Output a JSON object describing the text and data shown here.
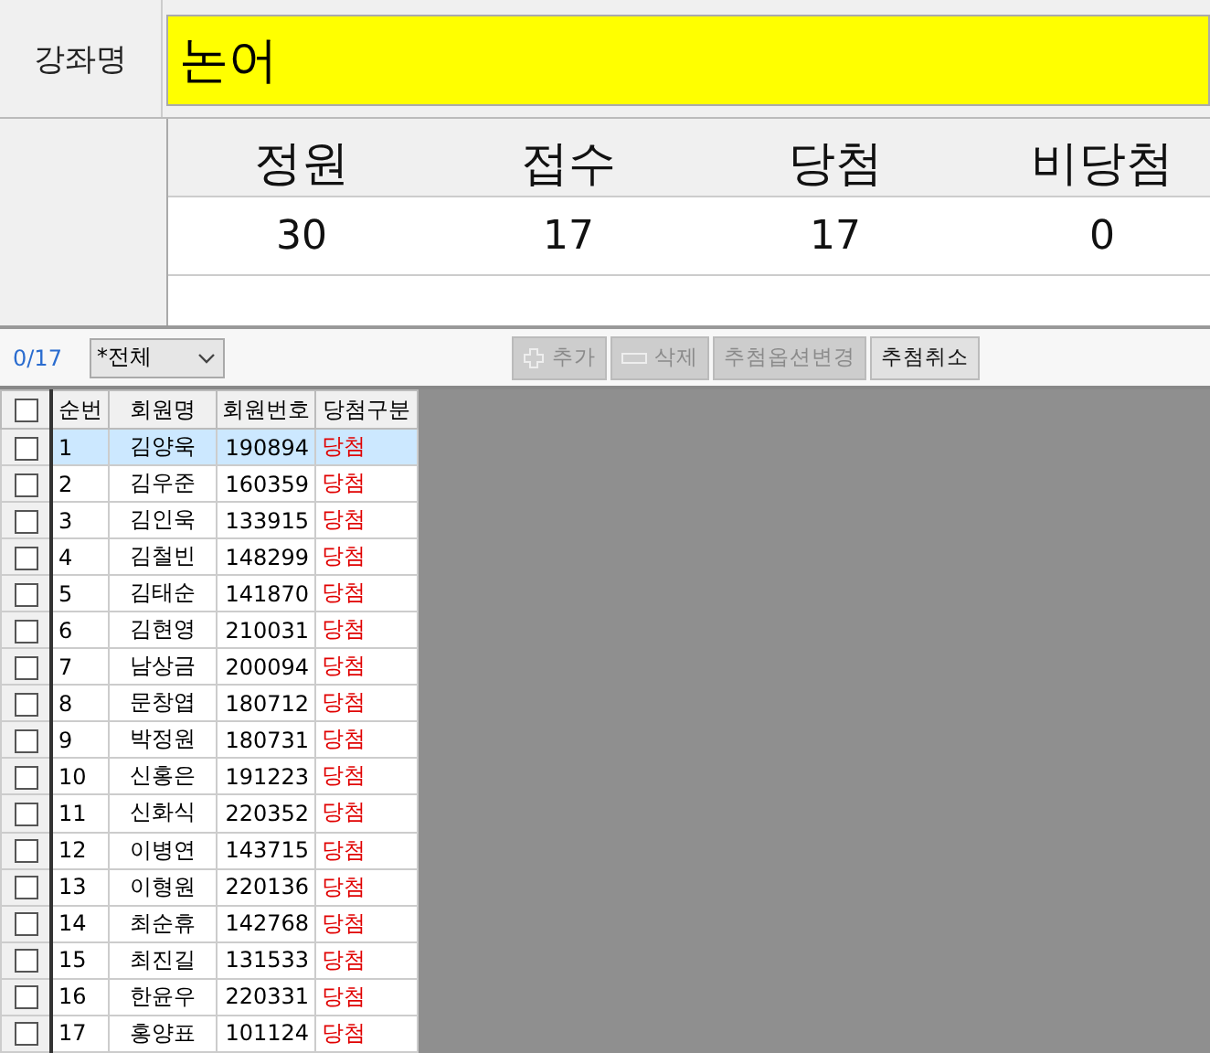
{
  "course": {
    "label": "강좌명",
    "value": "논어"
  },
  "stats": [
    {
      "header": "정원",
      "value": "30"
    },
    {
      "header": "접수",
      "value": "17"
    },
    {
      "header": "당첨",
      "value": "17"
    },
    {
      "header": "비당첨",
      "value": "0"
    }
  ],
  "toolbar": {
    "count": "0/17",
    "filter": "*전체",
    "buttons": [
      {
        "label": "추가",
        "kind": "plus",
        "disabled": true
      },
      {
        "label": "삭제",
        "kind": "minus",
        "disabled": true
      },
      {
        "label": "추첨옵션변경",
        "disabled": true
      },
      {
        "label": "추첨취소",
        "disabled": false
      }
    ]
  },
  "table": {
    "columns": [
      "순번",
      "회원명",
      "회원번호",
      "당첨구분"
    ],
    "header_checked": false,
    "rows": [
      {
        "no": "1",
        "name": "김양욱",
        "id": "190894",
        "result": "당첨",
        "checked": false,
        "selected": true
      },
      {
        "no": "2",
        "name": "김우준",
        "id": "160359",
        "result": "당첨",
        "checked": false,
        "selected": false
      },
      {
        "no": "3",
        "name": "김인욱",
        "id": "133915",
        "result": "당첨",
        "checked": false,
        "selected": false
      },
      {
        "no": "4",
        "name": "김철빈",
        "id": "148299",
        "result": "당첨",
        "checked": false,
        "selected": false
      },
      {
        "no": "5",
        "name": "김태순",
        "id": "141870",
        "result": "당첨",
        "checked": false,
        "selected": false
      },
      {
        "no": "6",
        "name": "김현영",
        "id": "210031",
        "result": "당첨",
        "checked": false,
        "selected": false
      },
      {
        "no": "7",
        "name": "남상금",
        "id": "200094",
        "result": "당첨",
        "checked": false,
        "selected": false
      },
      {
        "no": "8",
        "name": "문창엽",
        "id": "180712",
        "result": "당첨",
        "checked": false,
        "selected": false
      },
      {
        "no": "9",
        "name": "박정원",
        "id": "180731",
        "result": "당첨",
        "checked": false,
        "selected": false
      },
      {
        "no": "10",
        "name": "신홍은",
        "id": "191223",
        "result": "당첨",
        "checked": false,
        "selected": false
      },
      {
        "no": "11",
        "name": "신화식",
        "id": "220352",
        "result": "당첨",
        "checked": false,
        "selected": false
      },
      {
        "no": "12",
        "name": "이병연",
        "id": "143715",
        "result": "당첨",
        "checked": false,
        "selected": false
      },
      {
        "no": "13",
        "name": "이형원",
        "id": "220136",
        "result": "당첨",
        "checked": false,
        "selected": false
      },
      {
        "no": "14",
        "name": "최순휴",
        "id": "142768",
        "result": "당첨",
        "checked": false,
        "selected": false
      },
      {
        "no": "15",
        "name": "최진길",
        "id": "131533",
        "result": "당첨",
        "checked": false,
        "selected": false
      },
      {
        "no": "16",
        "name": "한윤우",
        "id": "220331",
        "result": "당첨",
        "checked": false,
        "selected": false
      },
      {
        "no": "17",
        "name": "홍양표",
        "id": "101124",
        "result": "당첨",
        "checked": false,
        "selected": false
      }
    ]
  }
}
